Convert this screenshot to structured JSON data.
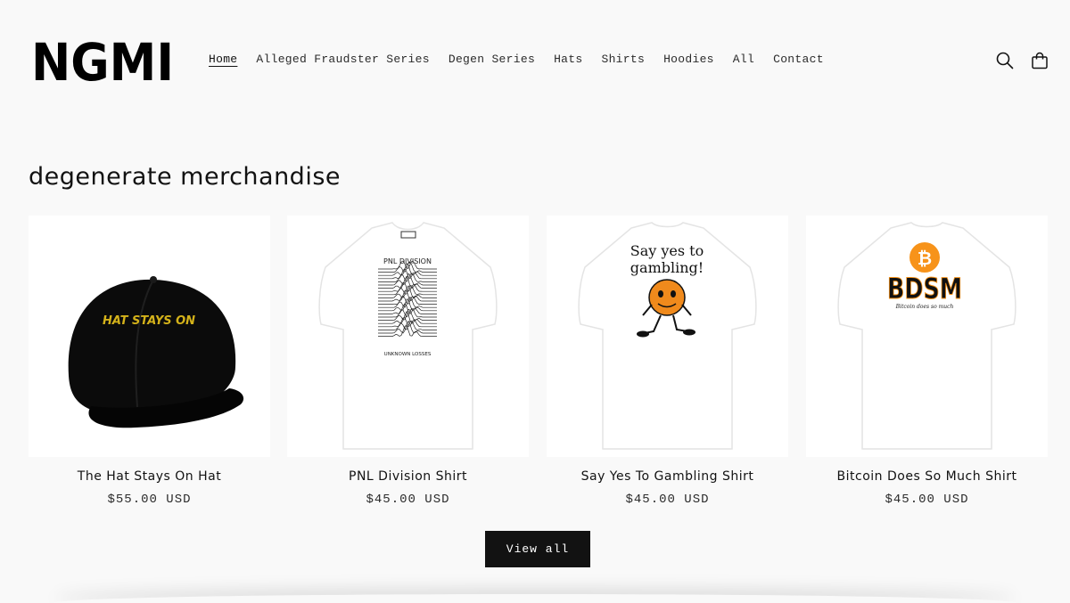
{
  "brand": {
    "logo_text": "NGMI"
  },
  "nav": {
    "items": [
      {
        "label": "Home",
        "active": true
      },
      {
        "label": "Alleged Fraudster Series",
        "active": false
      },
      {
        "label": "Degen Series",
        "active": false
      },
      {
        "label": "Hats",
        "active": false
      },
      {
        "label": "Shirts",
        "active": false
      },
      {
        "label": "Hoodies",
        "active": false
      },
      {
        "label": "All",
        "active": false
      },
      {
        "label": "Contact",
        "active": false
      }
    ]
  },
  "header_icons": {
    "search": "search-icon",
    "cart": "shopping-bag-icon"
  },
  "section": {
    "title": "degenerate merchandise"
  },
  "products": [
    {
      "title": "The Hat Stays On Hat",
      "price": "$55.00 USD",
      "image_text": "HAT STAYS ON"
    },
    {
      "title": "PNL Division Shirt",
      "price": "$45.00 USD",
      "image_text_top": "PNL DIVISION",
      "image_text_bottom": "UNKNOWN LOSSES"
    },
    {
      "title": "Say Yes To Gambling Shirt",
      "price": "$45.00 USD",
      "image_text_top": "Say yes to",
      "image_text_bottom": "gambling!"
    },
    {
      "title": "Bitcoin Does So Much Shirt",
      "price": "$45.00 USD",
      "image_text_top": "BDSM",
      "image_text_bottom": "Bitcoin does so much"
    }
  ],
  "view_all_label": "View all",
  "colors": {
    "background": "#f9f9f9",
    "text": "#121212",
    "button": "#121212",
    "bitcoin_orange": "#f7931a",
    "hat_text": "#d4b21a"
  }
}
